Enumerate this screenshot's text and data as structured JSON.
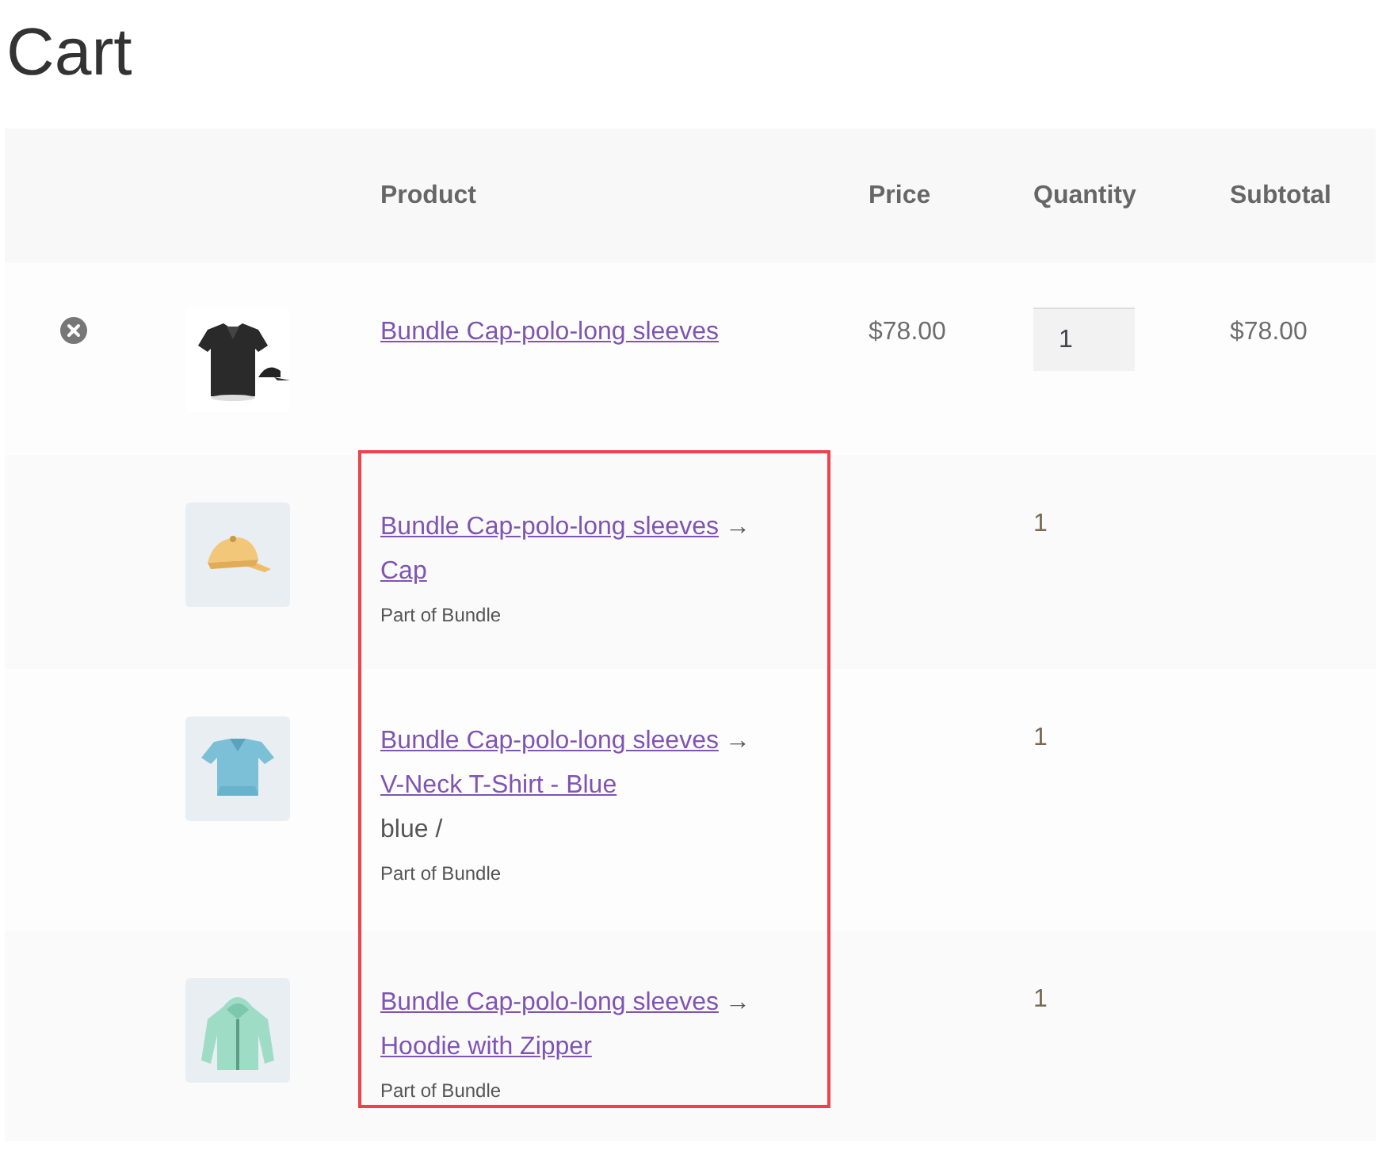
{
  "page_title": "Cart",
  "table": {
    "columns": [
      "Product",
      "Price",
      "Quantity",
      "Subtotal"
    ],
    "rows": [
      {
        "kind": "product",
        "removable": true,
        "name": "Bundle Cap-polo-long sleeves",
        "price": "$78.00",
        "quantity": "1",
        "subtotal": "$78.00"
      },
      {
        "kind": "bundled",
        "parent": "Bundle Cap-polo-long sleeves",
        "arrow": "→",
        "name": "Cap",
        "note": "Part of Bundle",
        "quantity": "1"
      },
      {
        "kind": "bundled",
        "parent": "Bundle Cap-polo-long sleeves",
        "arrow": "→",
        "name": "V-Neck T-Shirt - Blue",
        "variation": "blue /",
        "note": "Part of Bundle",
        "quantity": "1"
      },
      {
        "kind": "bundled",
        "parent": "Bundle Cap-polo-long sleeves",
        "arrow": "→",
        "name": "Hoodie with Zipper",
        "note": "Part of Bundle",
        "quantity": "1"
      }
    ]
  },
  "bundled_items_outlined": true
}
